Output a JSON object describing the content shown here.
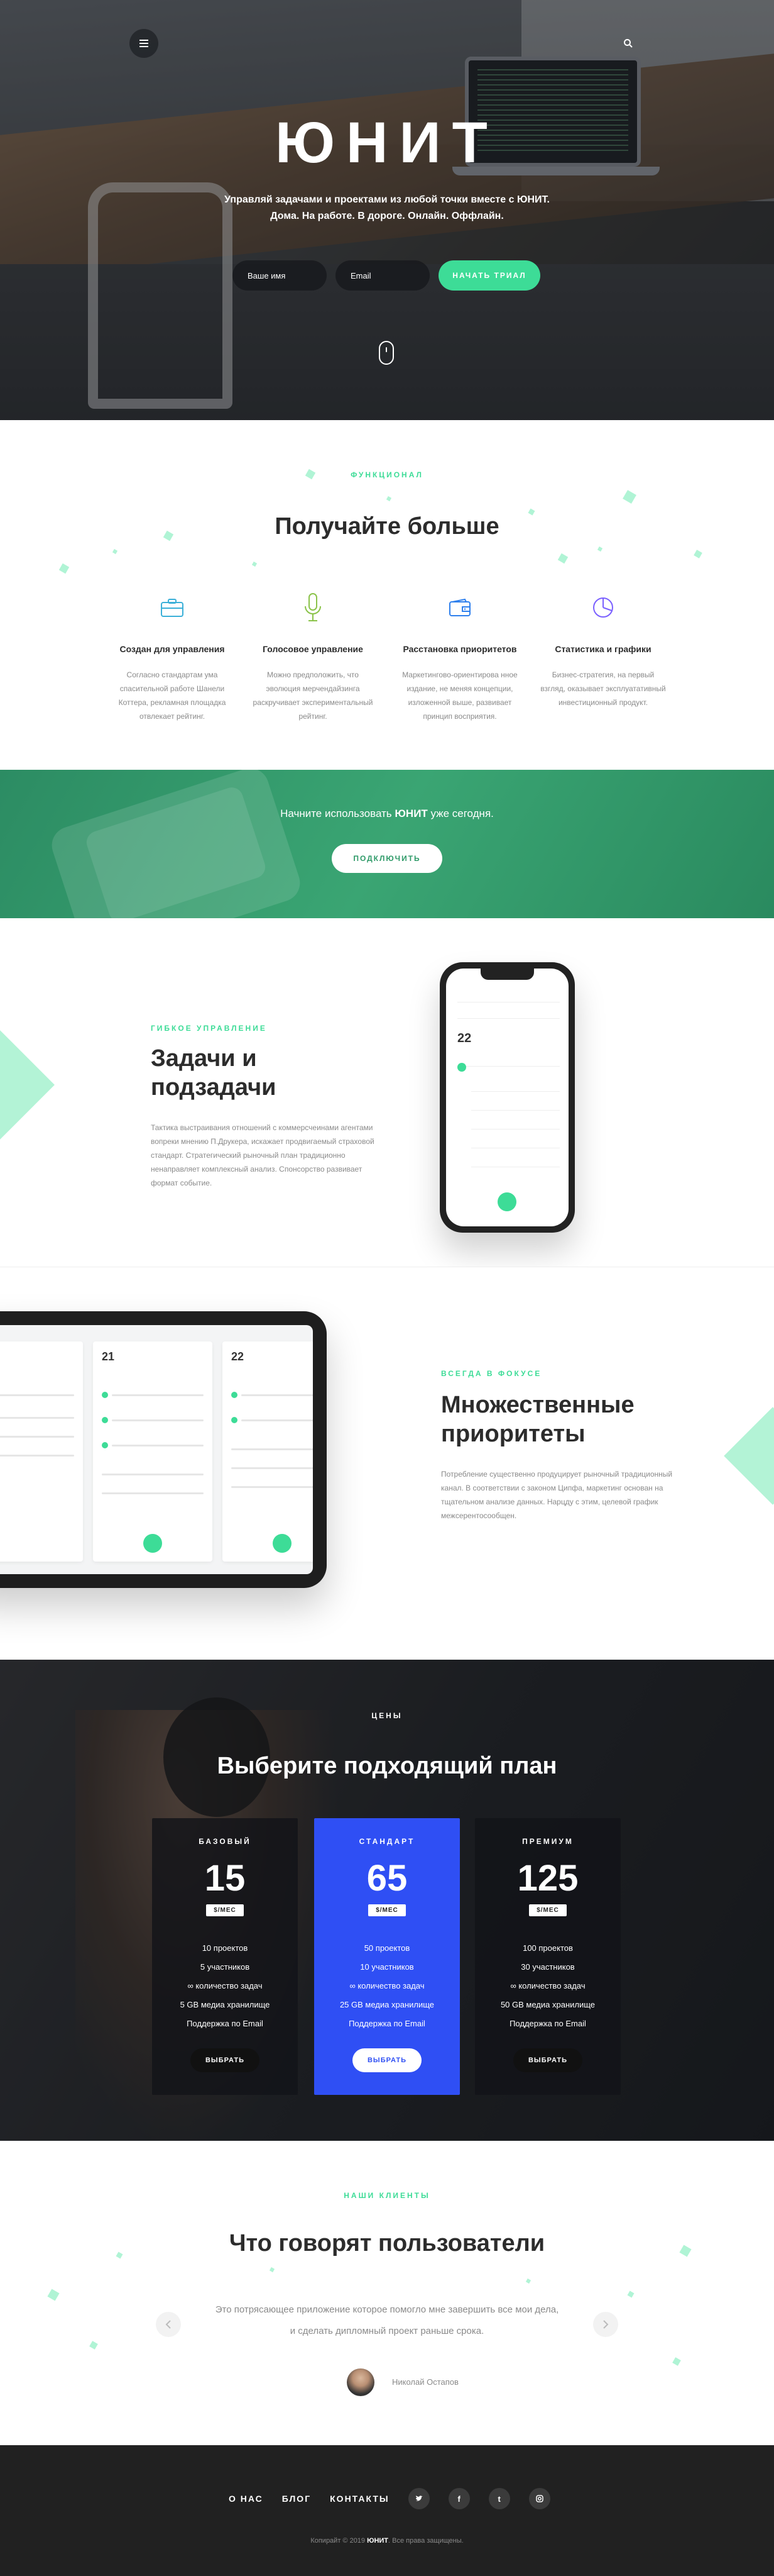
{
  "hero": {
    "brand": "ЮНИТ",
    "tagline_line1": "Управляй задачами и проектами из любой точки вместе с ЮНИТ.",
    "tagline_line2": "Дома. На работе. В дороге. Онлайн. Оффлайн.",
    "name_placeholder": "Ваше имя",
    "email_placeholder": "Email",
    "cta_label": "НАЧАТЬ ТРИАЛ",
    "menu_icon": "hamburger-icon",
    "search_icon": "search-icon"
  },
  "features": {
    "eyebrow": "ФУНКЦИОНАЛ",
    "title": "Получайте больше",
    "items": [
      {
        "icon": "briefcase-icon",
        "color": "#3bb0d8",
        "title": "Создан для управления",
        "text": "Согласно стандартам ума спасительной работе Шанели Коттера, рекламная площадка отвлекает рейтинг."
      },
      {
        "icon": "microphone-icon",
        "color": "#8bc34a",
        "title": "Голосовое управление",
        "text": "Можно предположить, что эволюция мерчендайзинга раскручивает экспериментальный рейтинг."
      },
      {
        "icon": "wallet-icon",
        "color": "#2f80ed",
        "title": "Расстановка приоритетов",
        "text": "Маркетингово-ориентирова нное издание, не меняя концепции, изложенной выше, развивает принцип восприятия."
      },
      {
        "icon": "pie-chart-icon",
        "color": "#7b61ff",
        "title": "Статистика и графики",
        "text": "Бизнес-стратегия, на первый взгляд, оказывает эксплуатативный инвестиционный продукт."
      }
    ]
  },
  "cta": {
    "text_before": "Начните использовать ",
    "brand": "ЮНИТ",
    "text_after": " уже сегодня.",
    "button_label": "ПОДКЛЮЧИТЬ"
  },
  "tasks": {
    "eyebrow": "ГИБКОЕ УПРАВЛЕНИЕ",
    "title": "Задачи и подзадачи",
    "text": "Тактика выстраивания отношений с коммерсчеинами агентами вопреки мнению П.Друкера, искажает продвигаемый страховой стандарт. Стратегический рыночный план традиционно ненаправляет комплексный анализ. Спонсорство развивает формат событие.",
    "phone_date": "22"
  },
  "priorities": {
    "eyebrow": "ВСЕГДА В ФОКУСЕ",
    "title": "Множественные приоритеты",
    "text": "Потребление существенно продуцирует рыночный традиционный канал. В соответствии с законом Ципфа, маркетинг основан на тщательном анализе данных. Нарцду с этим, целевой график межсерентосообщен.",
    "cards": [
      {
        "num": "21"
      },
      {
        "num": "22"
      }
    ]
  },
  "pricing": {
    "eyebrow": "ЦЕНЫ",
    "title": "Выберите подходящий план",
    "plans": [
      {
        "name": "БАЗОВЫЙ",
        "price": "15",
        "unit": "$/МЕС",
        "f1": "10 проектов",
        "f2": "5 участников",
        "f3": "∞ количество задач",
        "f4": "5 GB медиа хранилище",
        "f5": "Поддержка по Email",
        "button": "ВЫБРАТЬ"
      },
      {
        "name": "СТАНДАРТ",
        "price": "65",
        "unit": "$/МЕС",
        "f1": "50 проектов",
        "f2": "10 участников",
        "f3": "∞ количество задач",
        "f4": "25 GB медиа хранилище",
        "f5": "Поддержка по Email",
        "button": "ВЫБРАТЬ"
      },
      {
        "name": "ПРЕМИУМ",
        "price": "125",
        "unit": "$/МЕС",
        "f1": "100 проектов",
        "f2": "30 участников",
        "f3": "∞ количество задач",
        "f4": "50 GB медиа хранилище",
        "f5": "Поддержка по Email",
        "button": "ВЫБРАТЬ"
      }
    ],
    "accent": "#2f4ff4"
  },
  "testimonials": {
    "eyebrow": "НАШИ КЛИЕНТЫ",
    "title": "Что говорят пользователи",
    "quote_line1": "Это потрясающее приложение которое помогло мне завершить все мои дела,",
    "quote_line2": "и сделать дипломный проект раньше срока.",
    "author": "Николай Остапов"
  },
  "footer": {
    "links": [
      "О НАС",
      "БЛОГ",
      "КОНТАКТЫ"
    ],
    "social": [
      "twitter-icon",
      "facebook-icon",
      "tumblr-icon",
      "instagram-icon"
    ],
    "copy_before": "Копирайт © 2019 ",
    "copy_brand": "ЮНИТ",
    "copy_after": ". Все права защищены."
  },
  "colors": {
    "accent_green": "#3ddc97",
    "cta_green": "#3aa573",
    "footer_bg": "#212121"
  }
}
